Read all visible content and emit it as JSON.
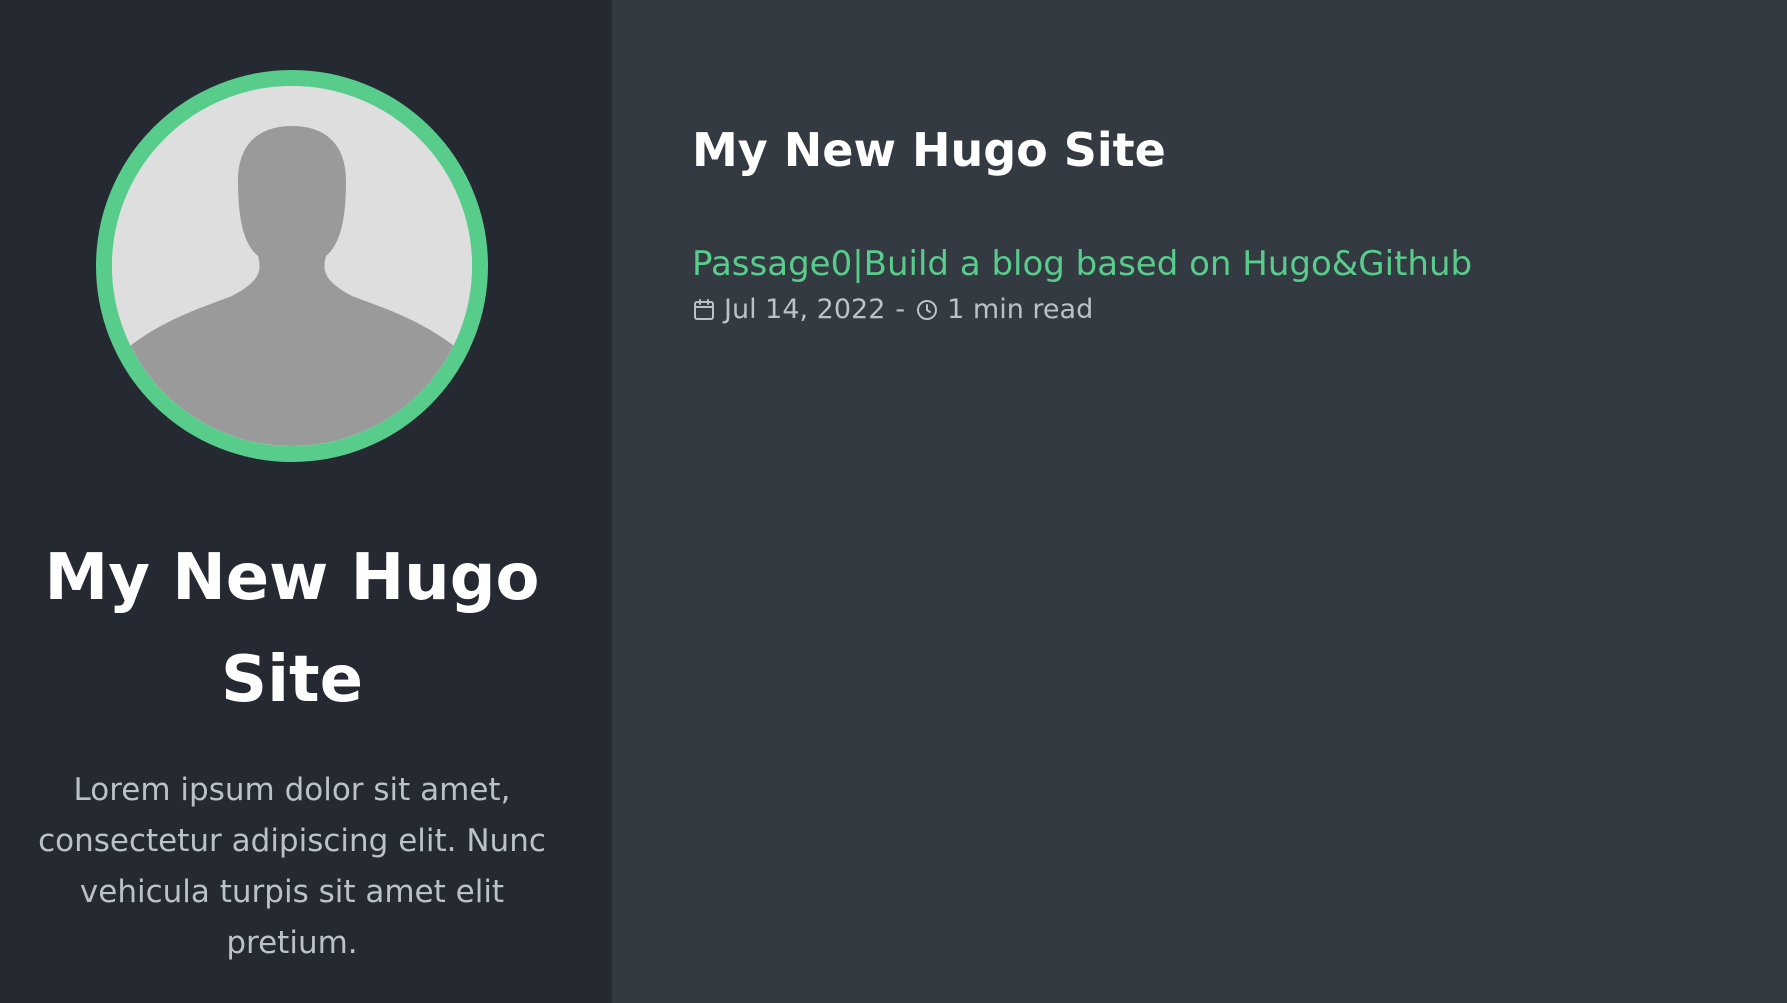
{
  "sidebar": {
    "avatar": {
      "icon": "user-silhouette-icon",
      "ring_color": "#58cc8b"
    },
    "title": "My New Hugo Site",
    "description": "Lorem ipsum dolor sit amet, consectetur adipiscing elit. Nunc vehicula turpis sit amet elit pretium."
  },
  "main": {
    "title": "My New Hugo Site",
    "posts": [
      {
        "title": "Passage0|Build a blog based on Hugo&Github",
        "date_icon": "calendar-icon",
        "date": "Jul 14, 2022",
        "separator": "-",
        "reading_icon": "clock-icon",
        "reading_time": "1 min read"
      }
    ]
  },
  "colors": {
    "accent": "#58cc8b",
    "sidebar_bg": "#252931",
    "main_bg": "#343a42",
    "muted_text": "#b9c1c9"
  }
}
